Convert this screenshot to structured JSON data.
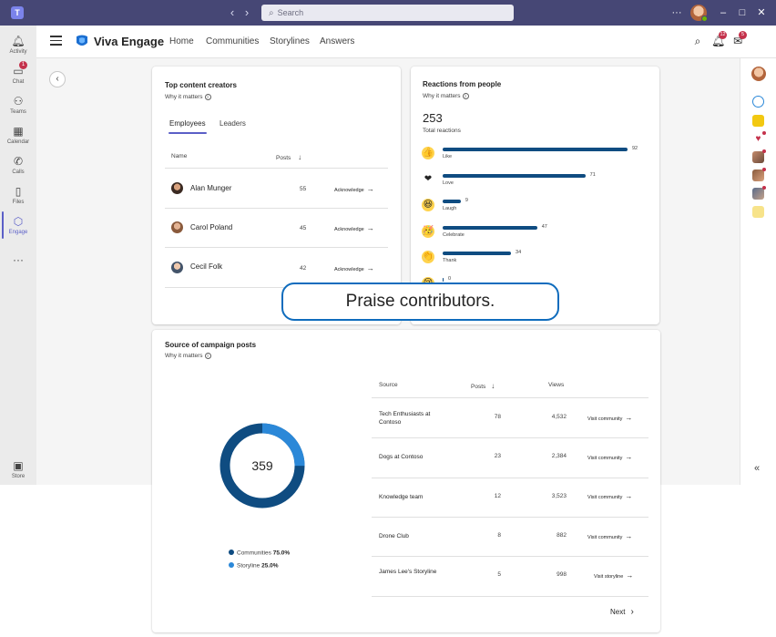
{
  "titlebar": {
    "search_placeholder": "Search",
    "more": "···",
    "minimize": "–",
    "maximize": "□",
    "close": "✕"
  },
  "rail": {
    "items": [
      {
        "label": "Activity",
        "icon": "bell-icon"
      },
      {
        "label": "Chat",
        "icon": "chat-icon",
        "badge": "1"
      },
      {
        "label": "Teams",
        "icon": "teams-icon"
      },
      {
        "label": "Calendar",
        "icon": "calendar-icon"
      },
      {
        "label": "Calls",
        "icon": "phone-icon"
      },
      {
        "label": "Files",
        "icon": "file-icon"
      },
      {
        "label": "Engage",
        "icon": "engage-icon",
        "active": true
      },
      {
        "label": "···",
        "icon": "more-icon"
      }
    ],
    "store_label": "Store"
  },
  "appbar": {
    "title": "Viva Engage",
    "nav": [
      "Home",
      "Communities",
      "Storylines",
      "Answers"
    ],
    "notification_badge": "12",
    "inbox_badge": "5"
  },
  "top_creators": {
    "title": "Top content creators",
    "why": "Why it matters",
    "tabs": [
      "Employees",
      "Leaders"
    ],
    "columns": {
      "name": "Name",
      "posts": "Posts"
    },
    "rows": [
      {
        "name": "Alan Munger",
        "posts": "55",
        "action": "Acknowledge"
      },
      {
        "name": "Carol Poland",
        "posts": "45",
        "action": "Acknowledge"
      },
      {
        "name": "Cecil Folk",
        "posts": "42",
        "action": "Acknowledge"
      }
    ]
  },
  "reactions": {
    "title": "Reactions from people",
    "why": "Why it matters",
    "total": "253",
    "total_label": "Total reactions",
    "items": [
      {
        "name": "Like",
        "value": 92,
        "emoji": "👍"
      },
      {
        "name": "Love",
        "value": 71,
        "emoji": "❤"
      },
      {
        "name": "Laugh",
        "value": 9,
        "emoji": "😆"
      },
      {
        "name": "Celebrate",
        "value": 47,
        "emoji": "🥳"
      },
      {
        "name": "Thank",
        "value": 34,
        "emoji": "👏"
      },
      {
        "name": "",
        "value": 0,
        "emoji": "😢"
      }
    ]
  },
  "callout": {
    "text": "Praise contributors."
  },
  "campaign": {
    "title": "Source of campaign posts",
    "why": "Why it matters",
    "total": "359",
    "legend": [
      {
        "label": "Communities",
        "percent": "75.0%",
        "color": "#0f4c81"
      },
      {
        "label": "Storyline",
        "percent": "25.0%",
        "color": "#2b88d8"
      }
    ],
    "columns": {
      "source": "Source",
      "posts": "Posts",
      "views": "Views"
    },
    "rows": [
      {
        "source": "Tech Enthusiasts at Contoso",
        "posts": "78",
        "views": "4,532",
        "action": "Visit community"
      },
      {
        "source": "Dogs at Contoso",
        "posts": "23",
        "views": "2,384",
        "action": "Visit community"
      },
      {
        "source": "Knowledge team",
        "posts": "12",
        "views": "3,523",
        "action": "Visit community"
      },
      {
        "source": "Drone Club",
        "posts": "8",
        "views": "882",
        "action": "Visit community"
      },
      {
        "source": "James Lee's Storyline",
        "posts": "5",
        "views": "998",
        "action": "Visit storyline"
      }
    ],
    "next": "Next"
  },
  "colors": {
    "titlebar": "#464775",
    "accent": "#5b5fc7",
    "bar": "#0f4c81",
    "donut_primary": "#0f4c81",
    "donut_secondary": "#2b88d8",
    "badge": "#c4314b"
  }
}
